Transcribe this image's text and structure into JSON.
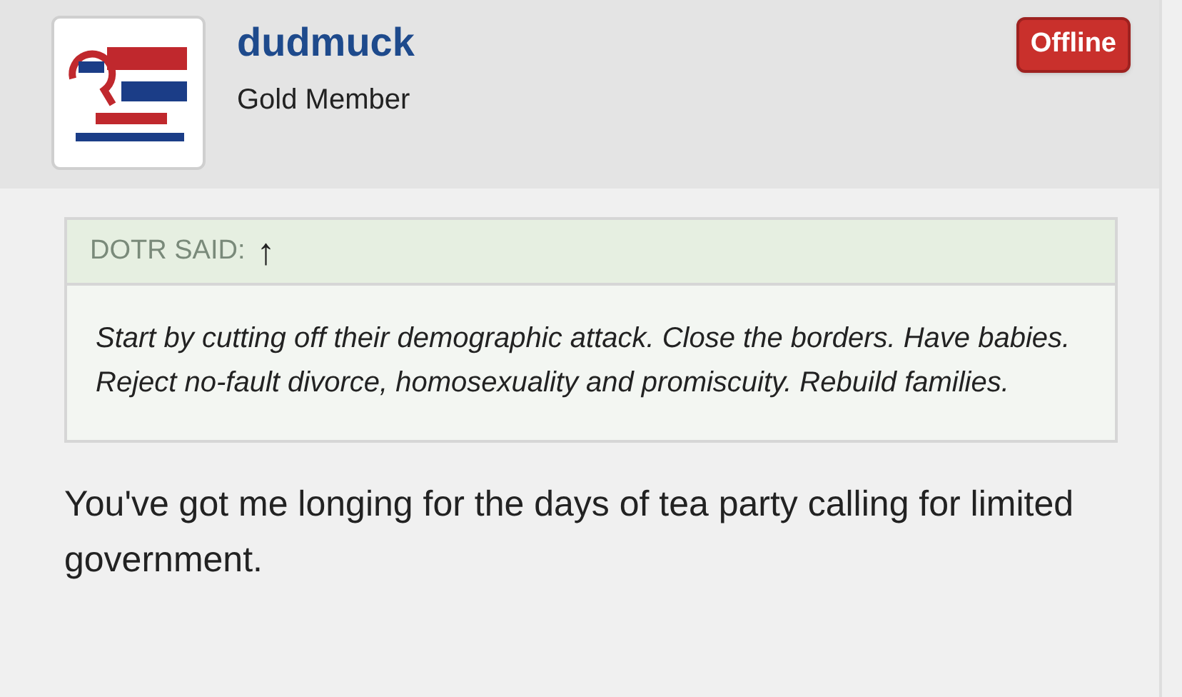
{
  "post": {
    "author": {
      "name": "dudmuck",
      "rank": "Gold Member",
      "status": {
        "label": "Offline",
        "online": false
      }
    },
    "quote": {
      "attribution": "DOTR SAID:",
      "jump_icon": "↑",
      "text": "Start by cutting off their demographic attack. Close the borders. Have babies. Reject no-fault divorce, homosexuality and promiscuity. Rebuild families."
    },
    "body": "You've got me longing for the days of tea party calling for limited government."
  }
}
